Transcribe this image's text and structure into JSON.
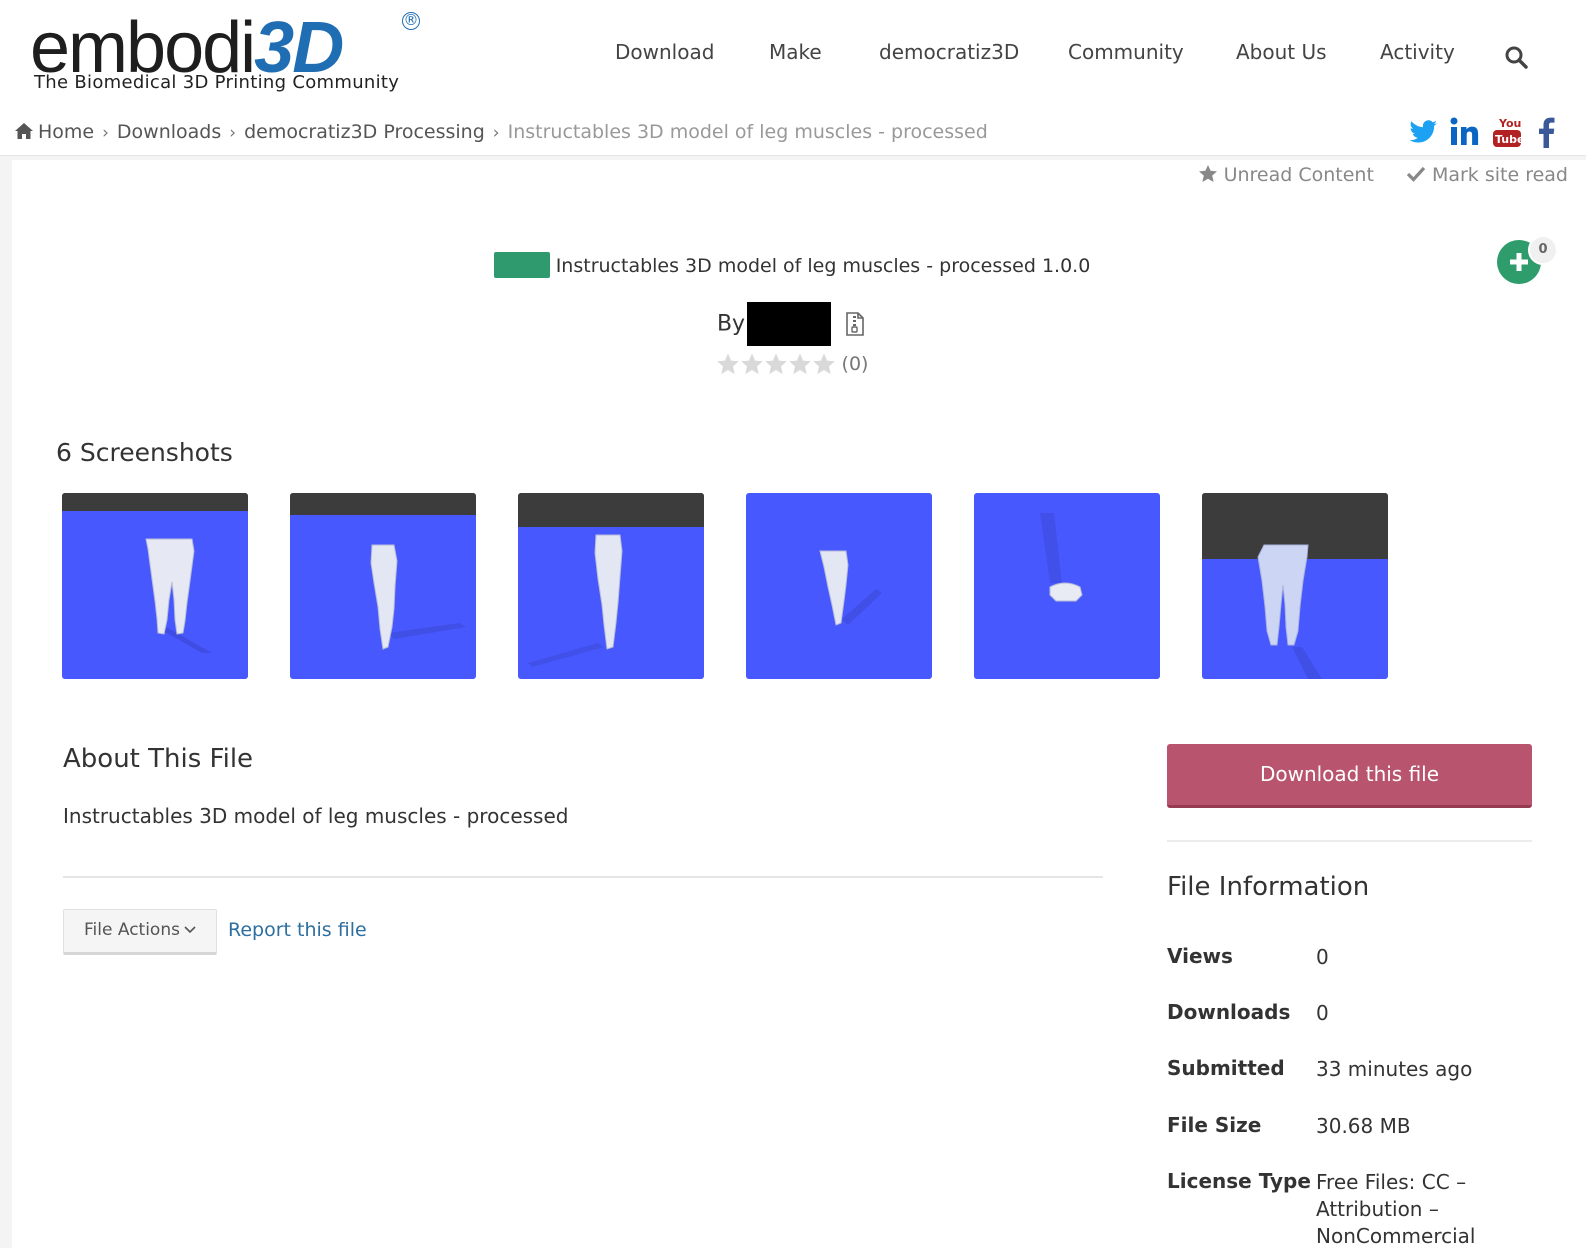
{
  "header": {
    "logo": {
      "wordmark_dark": "embodi",
      "wordmark_blue": "3D",
      "registered": "®",
      "tagline": "The Biomedical 3D Printing Community"
    },
    "nav": [
      {
        "label": "Download"
      },
      {
        "label": "Make"
      },
      {
        "label": "democratiz3D"
      },
      {
        "label": "Community"
      },
      {
        "label": "About Us"
      },
      {
        "label": "Activity"
      }
    ],
    "search_icon": "search-icon"
  },
  "breadcrumb": {
    "items": [
      "Home",
      "Downloads",
      "democratiz3D Processing"
    ],
    "current": "Instructables 3D model of leg muscles - processed",
    "separator": "›"
  },
  "social": [
    "twitter-icon",
    "linkedin-icon",
    "youtube-icon",
    "facebook-icon"
  ],
  "top_actions": {
    "unread": "Unread Content",
    "mark_read": "Mark site read"
  },
  "file": {
    "title": "Instructables 3D model of leg muscles - processed 1.0.0",
    "category_color": "#2f9a6e",
    "by_label": "By",
    "rating_count": "(0)",
    "rating_value": 0,
    "follow_count": "0"
  },
  "screenshots": {
    "heading": "6 Screenshots",
    "count": 6
  },
  "about": {
    "heading": "About This File",
    "description": "Instructables 3D model of leg muscles - processed",
    "file_actions_label": "File Actions",
    "report_label": "Report this file"
  },
  "sidebar": {
    "download_label": "Download this file",
    "info_heading": "File Information",
    "info": [
      {
        "key": "Views",
        "value": "0"
      },
      {
        "key": "Downloads",
        "value": "0"
      },
      {
        "key": "Submitted",
        "value": "33 minutes ago"
      },
      {
        "key": "File Size",
        "value": "30.68 MB"
      },
      {
        "key": "License Type",
        "value": "Free Files: CC – Attribution – NonCommercial"
      }
    ]
  },
  "colors": {
    "accent_blue": "#1f6db3",
    "download_button": "#b9546e",
    "follow_button": "#2e9d6b",
    "link": "#2d6fa0",
    "thumbnail_bg": "#4758ff"
  }
}
